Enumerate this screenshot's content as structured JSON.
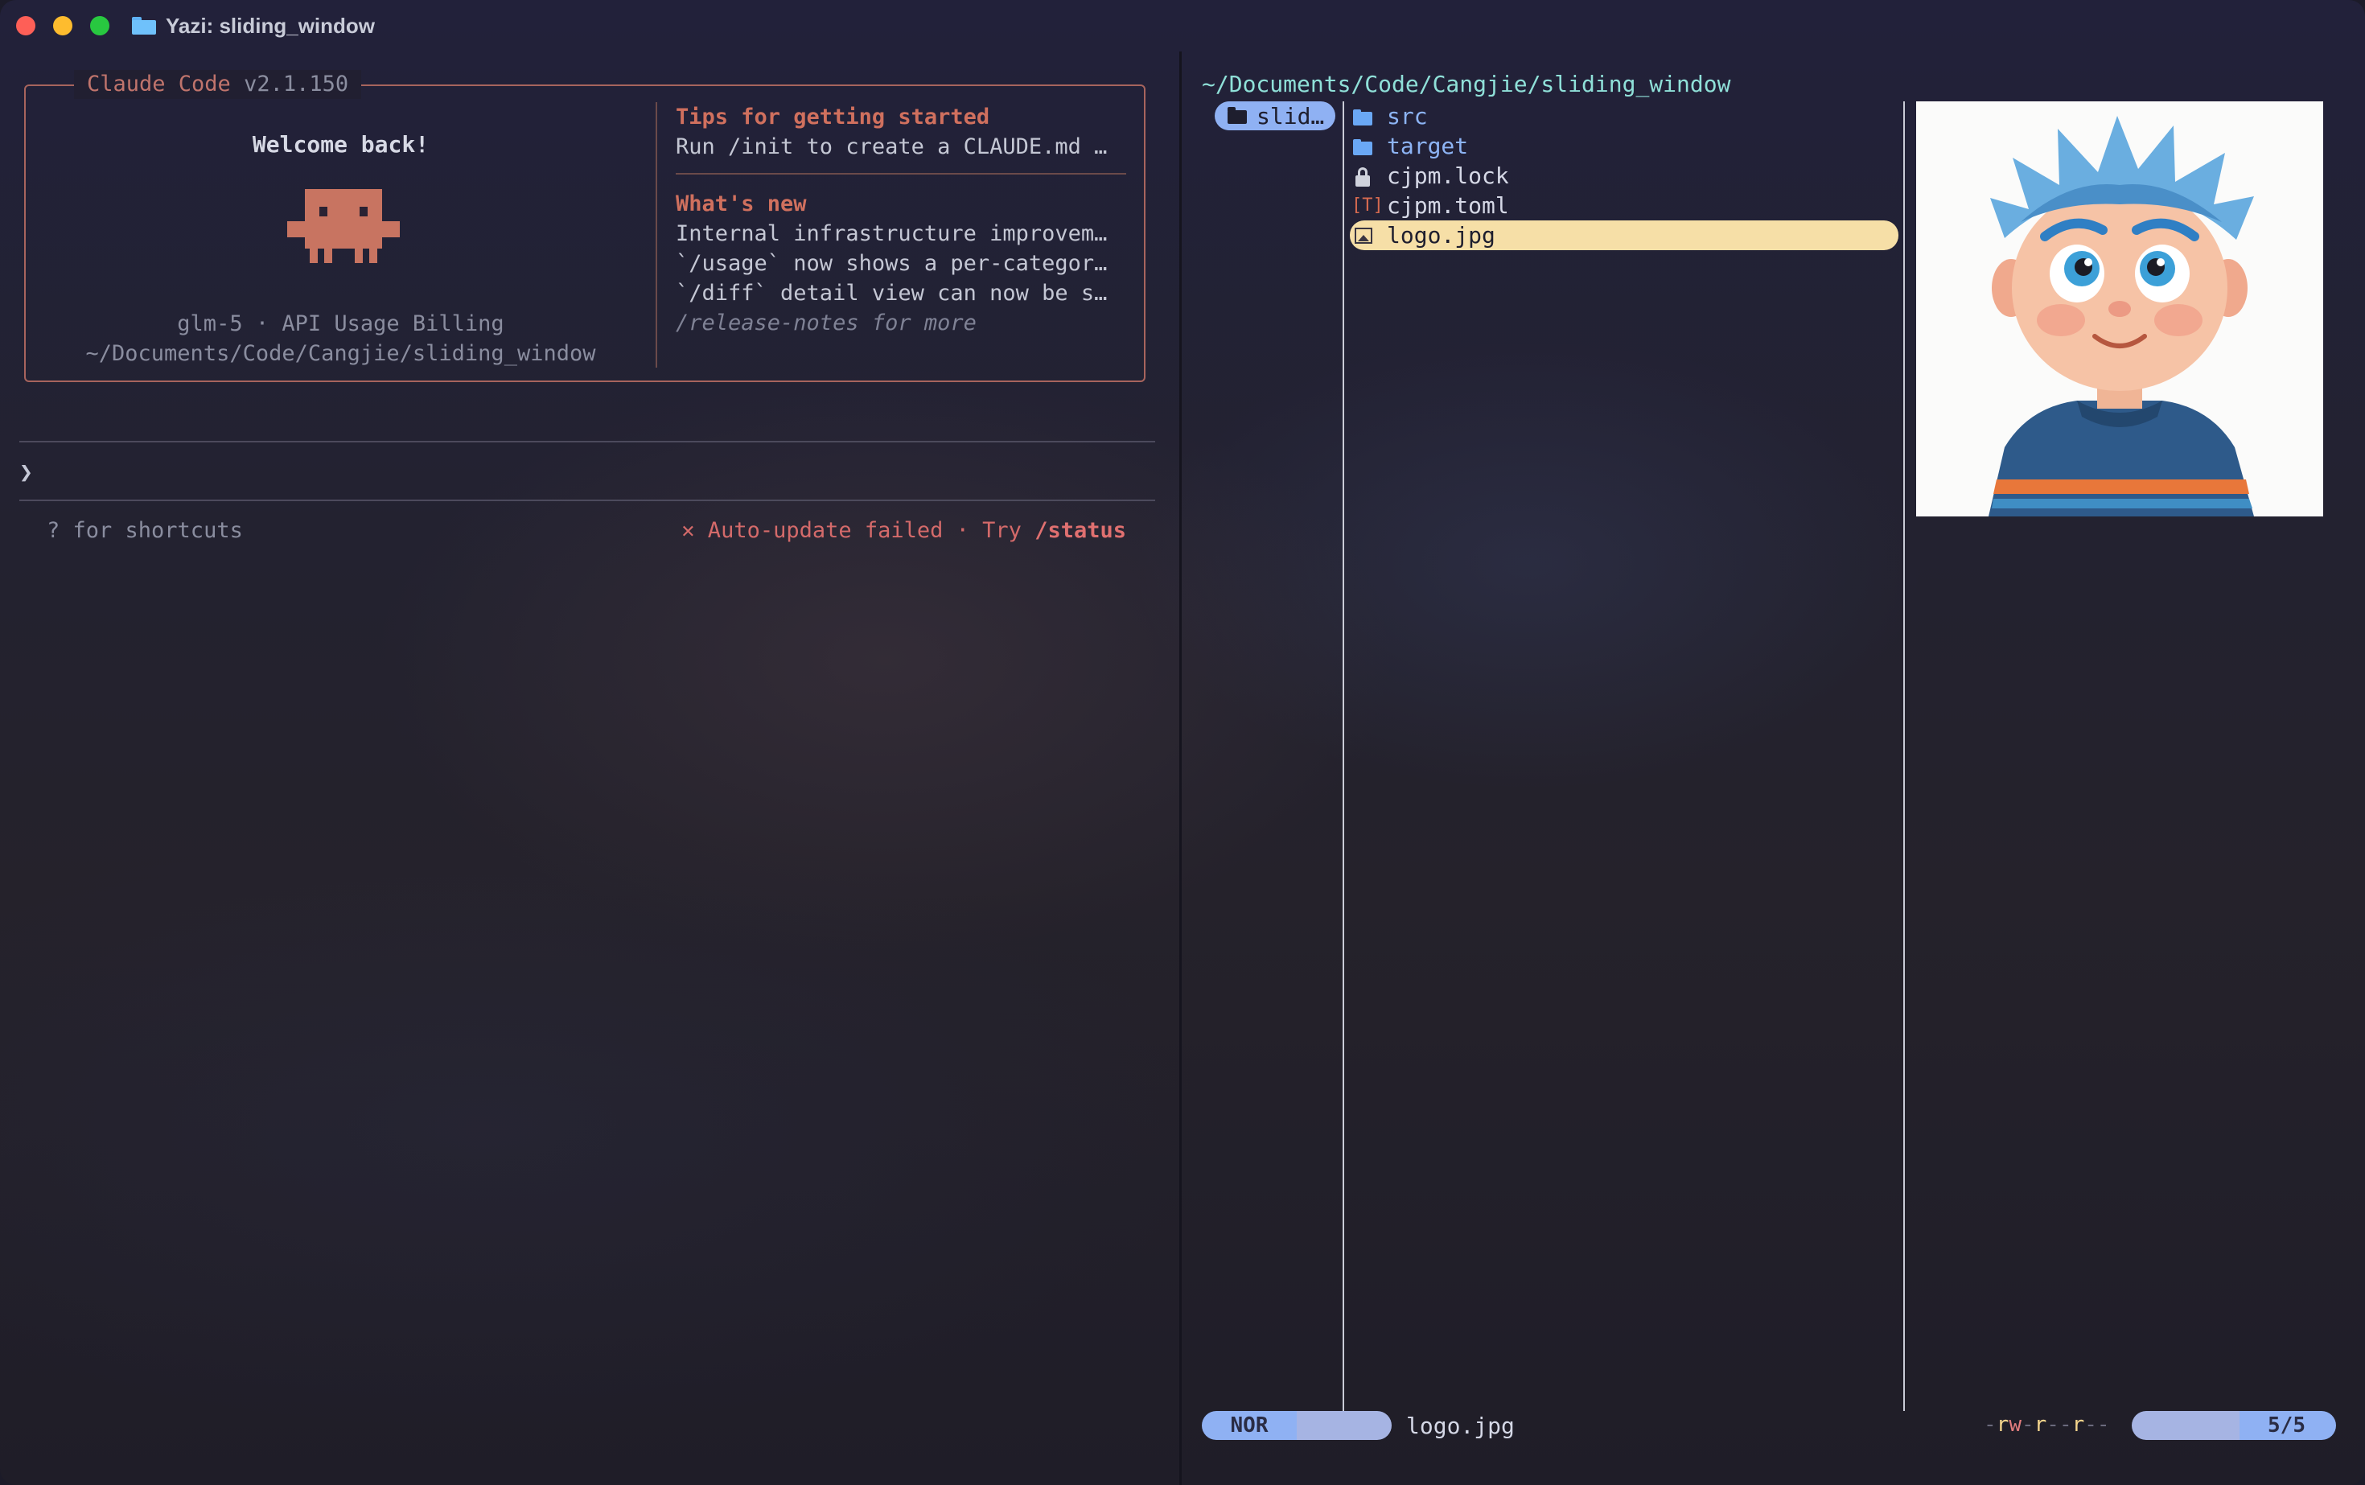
{
  "window": {
    "title": "Yazi: sliding_window"
  },
  "claude": {
    "app_name": "Claude Code",
    "version": "v2.1.150",
    "welcome": "Welcome back!",
    "model_line": "glm-5 · API Usage Billing",
    "cwd": "~/Documents/Code/Cangjie/sliding_window",
    "tips_heading": "Tips for getting started",
    "tips_text": "Run /init to create a CLAUDE.md …",
    "news_heading": "What's new",
    "news_items": [
      "Internal infrastructure improvem…",
      "`/usage` now shows a per-categor…",
      "`/diff` detail view can now be s…"
    ],
    "news_more": "/release-notes for more",
    "prompt_symbol": "❯",
    "shortcuts_hint": "? for shortcuts",
    "update_prefix": "✕ Auto-update failed · Try ",
    "update_cmd": "/status",
    "accent_color": "#d0705e"
  },
  "yazi": {
    "path": "~/Documents/Code/Cangjie/sliding_window",
    "parent_selected": "slid…",
    "files": [
      {
        "name": "src",
        "icon": "folder-icon",
        "type": "dir"
      },
      {
        "name": "target",
        "icon": "folder-icon",
        "type": "dir"
      },
      {
        "name": "cjpm.lock",
        "icon": "lock-icon",
        "type": "file"
      },
      {
        "name": "cjpm.toml",
        "icon": "toml-icon",
        "type": "file",
        "glyph": "[T]"
      },
      {
        "name": "logo.jpg",
        "icon": "image-icon",
        "type": "file",
        "selected": true
      }
    ],
    "status": {
      "mode": "NOR",
      "filename": "logo.jpg",
      "permissions": [
        "-",
        "r",
        "w",
        "-",
        "r",
        "-",
        "-",
        "r",
        "-",
        "-"
      ],
      "position": "5/5"
    },
    "selection_color": "#f6dfa7",
    "mode_color": "#8fb1f3"
  }
}
